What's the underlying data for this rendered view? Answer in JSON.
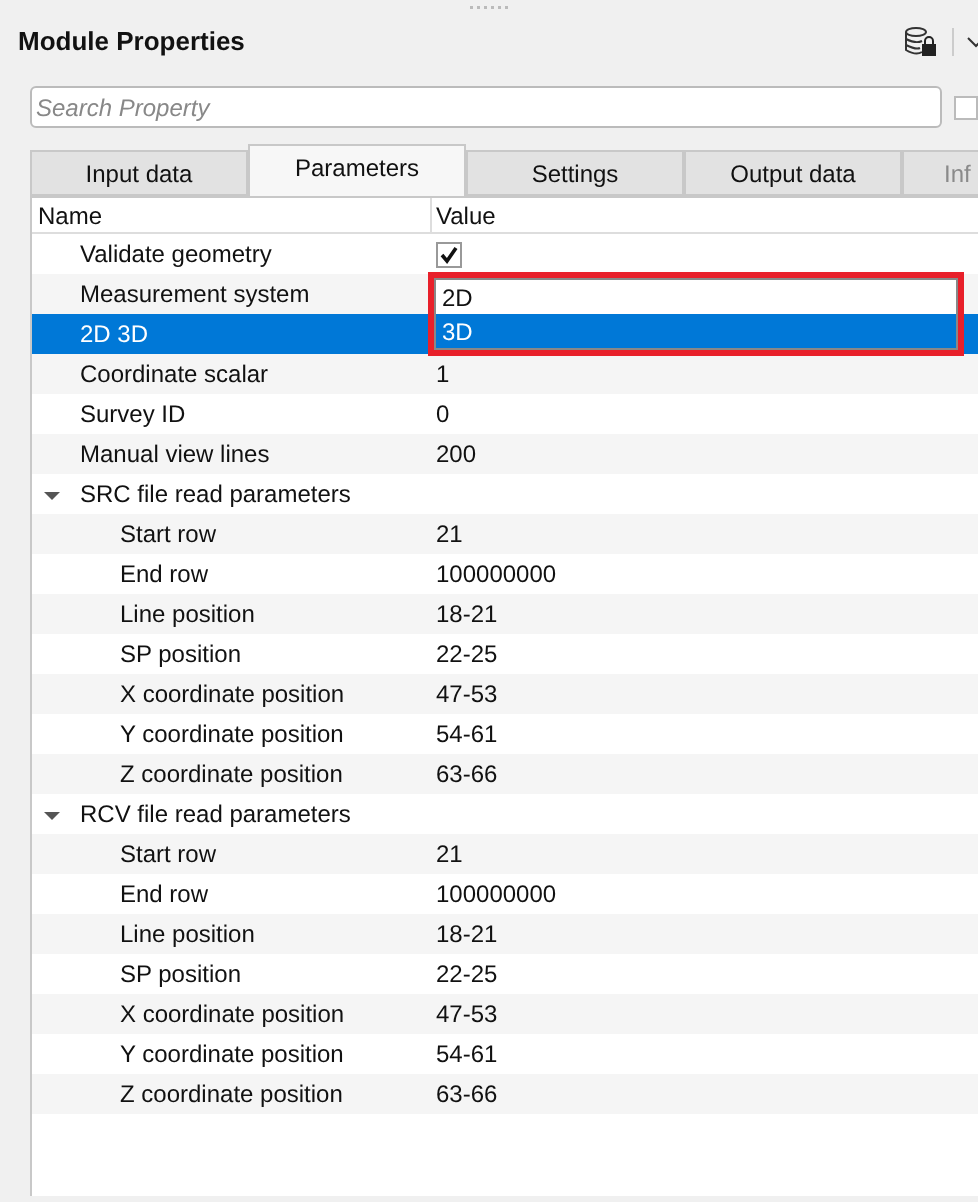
{
  "panel": {
    "title": "Module Properties"
  },
  "search": {
    "placeholder": "Search Property",
    "option_checked": false
  },
  "tabs": [
    {
      "label": "Input data",
      "selected": false,
      "disabled": false
    },
    {
      "label": "Parameters",
      "selected": true,
      "disabled": false
    },
    {
      "label": "Settings",
      "selected": false,
      "disabled": false
    },
    {
      "label": "Output data",
      "selected": false,
      "disabled": false
    },
    {
      "label": "Inf",
      "selected": false,
      "disabled": true
    }
  ],
  "table": {
    "columns": [
      "Name",
      "Value"
    ],
    "rows": [
      {
        "name": "Validate geometry",
        "kind": "checkbox",
        "checked": true,
        "selected": false
      },
      {
        "name": "Measurement system",
        "kind": "text",
        "selected": false
      },
      {
        "name": "2D 3D",
        "kind": "text",
        "selected": true
      },
      {
        "name": "Coordinate scalar",
        "kind": "text",
        "value": "1",
        "selected": false
      },
      {
        "name": "Survey ID",
        "kind": "text",
        "value": "0",
        "selected": false
      },
      {
        "name": "Manual view lines",
        "kind": "text",
        "value": "200",
        "selected": false
      },
      {
        "name": "SRC file read parameters",
        "kind": "group",
        "expanded": true,
        "selected": false,
        "children": [
          {
            "name": "Start row",
            "kind": "text",
            "value": "21",
            "selected": false
          },
          {
            "name": "End row",
            "kind": "text",
            "value": "100000000",
            "selected": false
          },
          {
            "name": "Line position",
            "kind": "text",
            "value": "18-21",
            "selected": false
          },
          {
            "name": "SP position",
            "kind": "text",
            "value": "22-25",
            "selected": false
          },
          {
            "name": "X coordinate position",
            "kind": "text",
            "value": "47-53",
            "selected": false
          },
          {
            "name": "Y coordinate position",
            "kind": "text",
            "value": "54-61",
            "selected": false
          },
          {
            "name": "Z coordinate position",
            "kind": "text",
            "value": "63-66",
            "selected": false
          }
        ]
      },
      {
        "name": "RCV file read parameters",
        "kind": "group",
        "expanded": true,
        "selected": false,
        "children": [
          {
            "name": "Start row",
            "kind": "text",
            "value": "21",
            "selected": false
          },
          {
            "name": "End row",
            "kind": "text",
            "value": "100000000",
            "selected": false
          },
          {
            "name": "Line position",
            "kind": "text",
            "value": "18-21",
            "selected": false
          },
          {
            "name": "SP position",
            "kind": "text",
            "value": "22-25",
            "selected": false
          },
          {
            "name": "X coordinate position",
            "kind": "text",
            "value": "47-53",
            "selected": false
          },
          {
            "name": "Y coordinate position",
            "kind": "text",
            "value": "54-61",
            "selected": false
          },
          {
            "name": "Z coordinate position",
            "kind": "text",
            "value": "63-66",
            "selected": false
          }
        ]
      }
    ]
  },
  "dropdown": {
    "options": [
      {
        "label": "2D",
        "selected": false
      },
      {
        "label": "3D",
        "selected": true
      }
    ]
  }
}
